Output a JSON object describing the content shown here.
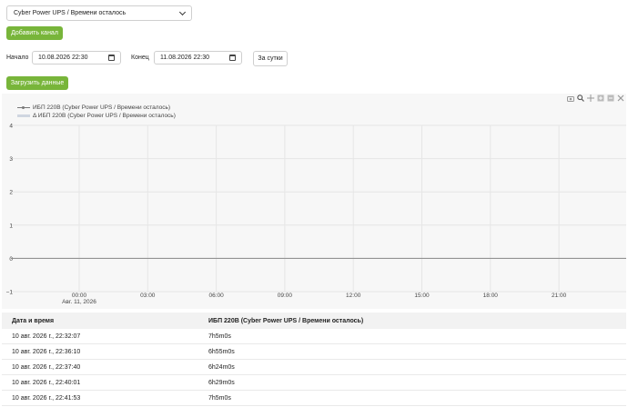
{
  "channel_select": {
    "value": "Cyber Power UPS / Времени осталось"
  },
  "add_channel_label": "Добавить канал",
  "range": {
    "start_label": "Начало",
    "start_value": "10.08.2026 22:30",
    "end_label": "Конец",
    "end_value": "11.08.2026 22:30",
    "day_button": "За сутки"
  },
  "load_label": "Загрузить данные",
  "modebar_icons": [
    "camera-icon",
    "zoom-icon",
    "pan-icon",
    "zoom-in-icon",
    "zoom-out-icon",
    "reset-axes-icon"
  ],
  "chart_data": {
    "type": "line",
    "series": [
      {
        "name": "ИБП 220В (Cyber Power UPS / Времени осталось)",
        "values": []
      },
      {
        "name": "Δ ИБП 220В (Cyber Power UPS / Времени осталось)",
        "values": []
      }
    ],
    "y_ticks": [
      "4",
      "3",
      "2",
      "1",
      "0",
      "−1"
    ],
    "ylim": [
      -1,
      4
    ],
    "x_ticks": [
      "00:00",
      "03:00",
      "06:00",
      "09:00",
      "12:00",
      "15:00",
      "18:00",
      "21:00"
    ],
    "x_date_label": "Авг. 11, 2026",
    "zero_line": 0,
    "grid": true,
    "legend_position": "top-left"
  },
  "table": {
    "headers": [
      "Дата и время",
      "ИБП 220В (Cyber Power UPS / Времени осталось)"
    ],
    "rows": [
      [
        "10 авг. 2026 г., 22:32:07",
        "7h5m0s"
      ],
      [
        "10 авг. 2026 г., 22:36:10",
        "6h55m0s"
      ],
      [
        "10 авг. 2026 г., 22:37:40",
        "6h24m0s"
      ],
      [
        "10 авг. 2026 г., 22:40:01",
        "6h29m0s"
      ],
      [
        "10 авг. 2026 г., 22:41:53",
        "7h5m0s"
      ]
    ]
  }
}
